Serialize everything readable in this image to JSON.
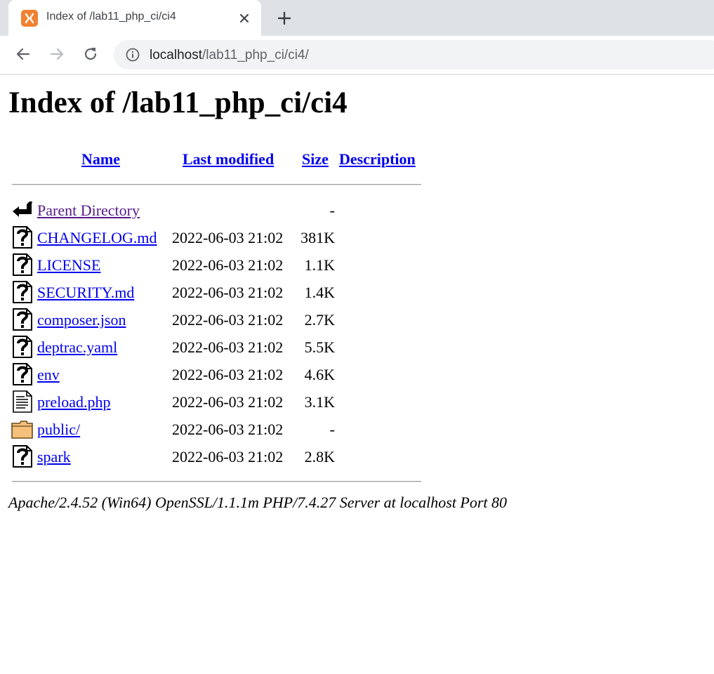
{
  "browser": {
    "tab_title": "Index of /lab11_php_ci/ci4",
    "url_host": "localhost",
    "url_path": "/lab11_php_ci/ci4/"
  },
  "page": {
    "heading": "Index of /lab11_php_ci/ci4",
    "columns": {
      "name": "Name",
      "last_modified": "Last modified",
      "size": "Size",
      "description": "Description"
    },
    "rows": [
      {
        "icon": "back-icon",
        "name": "Parent Directory",
        "date": "",
        "size": "-"
      },
      {
        "icon": "unknown-file-icon",
        "name": "CHANGELOG.md",
        "date": "2022-06-03 21:02",
        "size": "381K"
      },
      {
        "icon": "unknown-file-icon",
        "name": "LICENSE",
        "date": "2022-06-03 21:02",
        "size": "1.1K"
      },
      {
        "icon": "unknown-file-icon",
        "name": "SECURITY.md",
        "date": "2022-06-03 21:02",
        "size": "1.4K"
      },
      {
        "icon": "unknown-file-icon",
        "name": "composer.json",
        "date": "2022-06-03 21:02",
        "size": "2.7K"
      },
      {
        "icon": "unknown-file-icon",
        "name": "deptrac.yaml",
        "date": "2022-06-03 21:02",
        "size": "5.5K"
      },
      {
        "icon": "unknown-file-icon",
        "name": "env",
        "date": "2022-06-03 21:02",
        "size": "4.6K"
      },
      {
        "icon": "text-file-icon",
        "name": "preload.php",
        "date": "2022-06-03 21:02",
        "size": "3.1K"
      },
      {
        "icon": "folder-icon",
        "name": "public/",
        "date": "2022-06-03 21:02",
        "size": "-"
      },
      {
        "icon": "unknown-file-icon",
        "name": "spark",
        "date": "2022-06-03 21:02",
        "size": "2.8K"
      }
    ],
    "footer": "Apache/2.4.52 (Win64) OpenSSL/1.1.1m PHP/7.4.27 Server at localhost Port 80"
  }
}
